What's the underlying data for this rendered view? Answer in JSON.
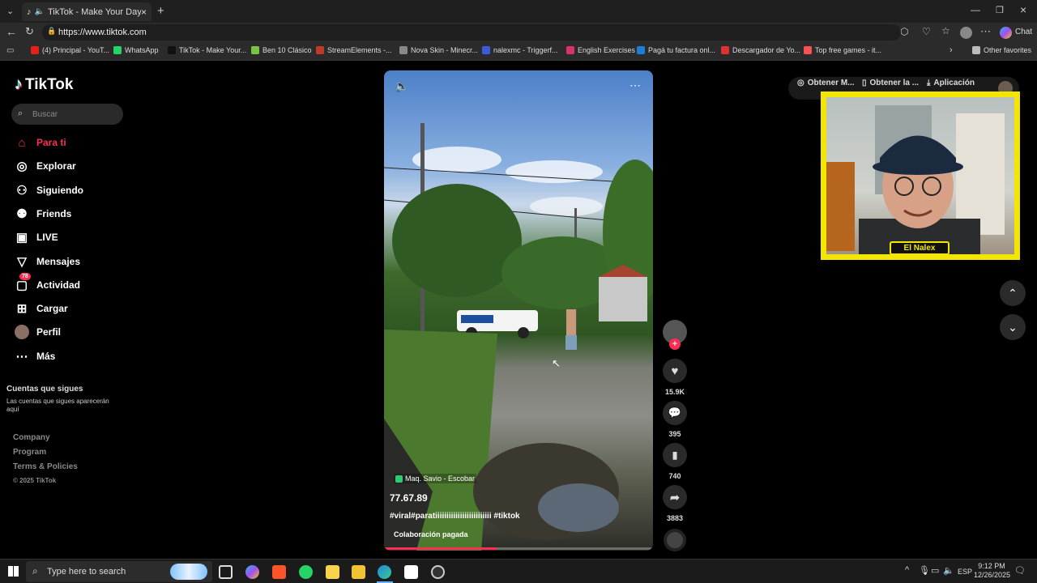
{
  "browser": {
    "tab_title": "TikTok - Make Your Day",
    "url": "https://www.tiktok.com",
    "chat_label": "Chat",
    "bookmarks": [
      {
        "label": "(4) Principal - YouT...",
        "color": "#e62117"
      },
      {
        "label": "WhatsApp",
        "color": "#25d366"
      },
      {
        "label": "TikTok - Make Your...",
        "color": "#111111"
      },
      {
        "label": "Ben 10 Clásico",
        "color": "#7cc242"
      },
      {
        "label": "StreamElements -...",
        "color": "#c0392b"
      },
      {
        "label": "Nova Skin - Minecr...",
        "color": "#888888"
      },
      {
        "label": "nalexmc - Triggerf...",
        "color": "#3b5bdb"
      },
      {
        "label": "English Exercises",
        "color": "#d6336c"
      },
      {
        "label": "Pagá tu factura onl...",
        "color": "#1c7ed6"
      },
      {
        "label": "Descargador de Yo...",
        "color": "#e03131"
      },
      {
        "label": "Top free games - it...",
        "color": "#fa5252"
      }
    ],
    "other_favorites": "Other favorites"
  },
  "sidebar": {
    "logo": "TikTok",
    "search_placeholder": "Buscar",
    "items": [
      {
        "label": "Para ti",
        "icon": "home-icon",
        "active": true
      },
      {
        "label": "Explorar",
        "icon": "compass-icon"
      },
      {
        "label": "Siguiendo",
        "icon": "following-icon"
      },
      {
        "label": "Friends",
        "icon": "friends-icon"
      },
      {
        "label": "LIVE",
        "icon": "live-icon"
      },
      {
        "label": "Mensajes",
        "icon": "messages-icon"
      },
      {
        "label": "Actividad",
        "icon": "activity-icon",
        "badge": "78"
      },
      {
        "label": "Cargar",
        "icon": "upload-icon"
      },
      {
        "label": "Perfil",
        "icon": "profile-avatar"
      },
      {
        "label": "Más",
        "icon": "more-icon"
      }
    ],
    "following_title": "Cuentas que sigues",
    "following_subtitle": "Las cuentas que sigues aparecerán aquí",
    "footer": [
      "Company",
      "Program",
      "Terms & Policies",
      "© 2025 TikTok"
    ]
  },
  "top_actions": {
    "get_coins": "Obtener M...",
    "get_app": "Obtener la ...",
    "app": "Aplicación"
  },
  "video": {
    "location": "Maq. Savio - Escobar",
    "author": "77.67.89",
    "caption": "#viral#paratiiiiiiiiiiiiiiiiiiiiiiiii #tiktok",
    "paid": "Colaboración pagada",
    "progress": 0.42
  },
  "actions": {
    "likes": "15.9K",
    "comments": "395",
    "saves": "740",
    "shares": "3883"
  },
  "overlay": {
    "streamer_name": "El Nalex"
  },
  "taskbar": {
    "search_placeholder": "Type here to search",
    "lang": "ESP",
    "time": "9:12 PM",
    "date": "12/26/2025"
  }
}
